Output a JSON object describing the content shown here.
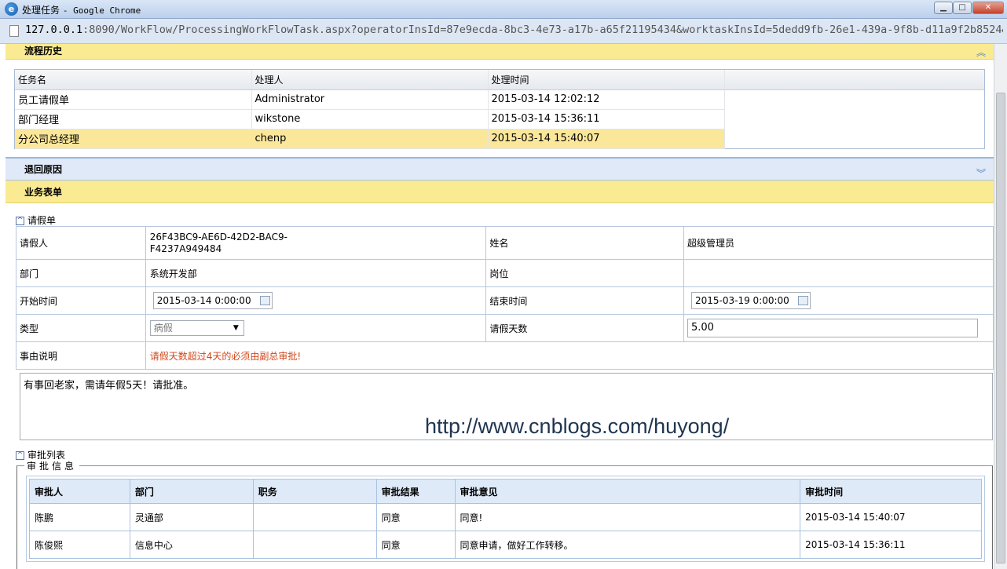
{
  "window": {
    "title": "处理任务",
    "app": "Google Chrome",
    "url_host": "127.0.0.1",
    "url_rest": ":8090/WorkFlow/ProcessingWorkFlowTask.aspx?operatorInsId=87e9ecda-8bc3-4e73-a17b-a65f21195434&worktaskInsId=5dedd9fb-26e1-439a-9f8b-d11a9f2b8524&wo"
  },
  "history": {
    "title": "流程历史",
    "columns": [
      "任务名",
      "处理人",
      "处理时间"
    ],
    "rows": [
      {
        "task": "员工请假单",
        "handler": "Administrator",
        "time": "2015-03-14 12:02:12"
      },
      {
        "task": "部门经理",
        "handler": "wikstone",
        "time": "2015-03-14 15:36:11"
      },
      {
        "task": "分公司总经理",
        "handler": "chenp",
        "time": "2015-03-14 15:40:07"
      }
    ]
  },
  "return_reason": {
    "title": "退回原因"
  },
  "business_form": {
    "title": "业务表单"
  },
  "leave_form": {
    "section_title": "请假单",
    "applicant_label": "请假人",
    "applicant_value_1": "26F43BC9-AE6D-42D2-BAC9-",
    "applicant_value_2": "F4237A949484",
    "name_label": "姓名",
    "name_value": "超级管理员",
    "dept_label": "部门",
    "dept_value": "系统开发部",
    "position_label": "岗位",
    "start_label": "开始时间",
    "start_value": "2015-03-14 0:00:00",
    "end_label": "结束时间",
    "end_value": "2015-03-19 0:00:00",
    "type_label": "类型",
    "type_value": "病假",
    "days_label": "请假天数",
    "days_value": "5.00",
    "reason_label": "事由说明",
    "reason_note": "请假天数超过4天的必须由副总审批!",
    "reason_text": "有事回老家，需请年假5天！请批准。"
  },
  "watermark": "http://www.cnblogs.com/huyong/",
  "approval": {
    "section_title": "审批列表",
    "legend": "审批信息",
    "columns": [
      "审批人",
      "部门",
      "职务",
      "审批结果",
      "审批意见",
      "审批时间"
    ],
    "rows": [
      {
        "approver": "陈鹏",
        "dept": "灵通部",
        "duty": "",
        "result": "同意",
        "opinion": "同意!",
        "time": "2015-03-14 15:40:07"
      },
      {
        "approver": "陈俊熙",
        "dept": "信息中心",
        "duty": "",
        "result": "同意",
        "opinion": "同意申请，做好工作转移。",
        "time": "2015-03-14 15:36:11"
      }
    ]
  }
}
